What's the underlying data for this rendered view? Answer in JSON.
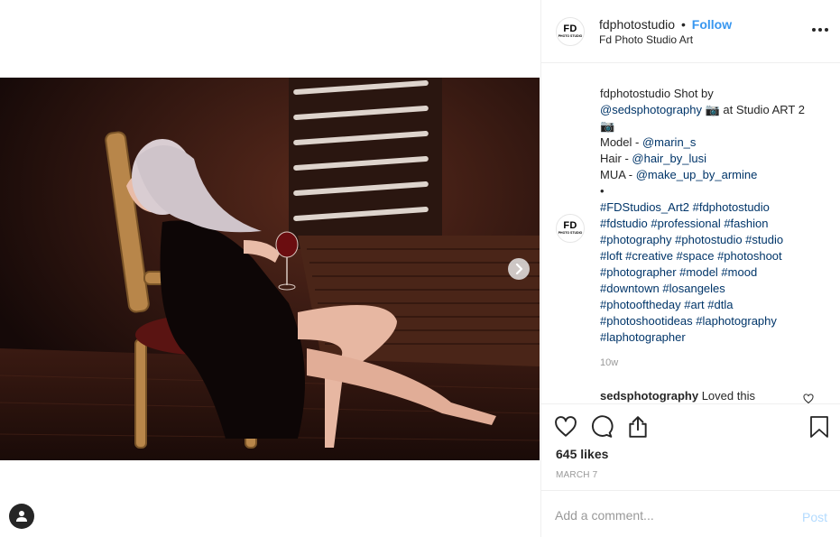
{
  "header": {
    "username": "fdphotostudio",
    "separator": "•",
    "follow_label": "Follow",
    "location": "Fd Photo Studio Art",
    "logo_text": "FD",
    "logo_sub": "PHOTO STUDIO"
  },
  "caption": {
    "username": "fdphotostudio",
    "lines": [
      {
        "text": "Shot by"
      },
      {
        "mention": "@sedsphotography",
        "tail": "📷 at Studio ART 2"
      },
      {
        "text": "📷"
      },
      {
        "label": "Model - ",
        "mention": "@marin_s"
      },
      {
        "label": "Hair - ",
        "mention": "@hair_by_lusi"
      },
      {
        "label": "MUA - ",
        "mention": "@make_up_by_armine"
      },
      {
        "text": "•"
      }
    ],
    "hashtag_lines": [
      "#FDStudios_Art2 #fdphotostudio",
      "#fdstudio #professional #fashion",
      "#photography #photostudio #studio",
      "#loft #creative #space #photoshoot",
      "#photographer #model #mood",
      "#downtown #losangeles",
      "#photooftheday #art #dtla",
      "#photoshootideas #laphotography",
      "#laphotographer"
    ],
    "age": "10w"
  },
  "comment2": {
    "username": "sedsphotography",
    "text": "Loved this"
  },
  "actions": {
    "likes": "645 likes",
    "date": "MARCH 7"
  },
  "add_comment": {
    "placeholder": "Add a comment...",
    "post_label": "Post"
  },
  "icons": {
    "like": "heart-icon",
    "comment": "comment-bubble-icon",
    "share": "share-icon",
    "save": "bookmark-icon",
    "more": "more-dots-icon",
    "next": "chevron-right-icon",
    "user": "user-icon"
  },
  "colors": {
    "link": "#3897f0",
    "mention": "#003569",
    "post_disabled": "#b3dbff",
    "muted": "#999999"
  }
}
